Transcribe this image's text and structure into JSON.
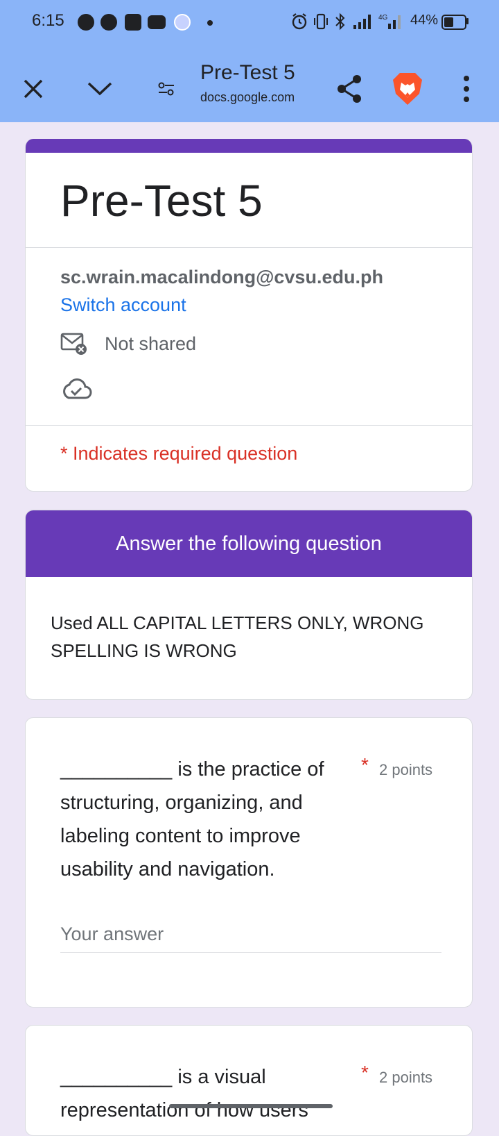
{
  "status_bar": {
    "time": "6:15",
    "battery": "44%",
    "icons": [
      "messenger-icon",
      "shopee-icon",
      "youtube-icon",
      "app-notification-icon",
      "alarm-icon",
      "vibrate-icon",
      "bluetooth-icon",
      "signal-icon",
      "4g-signal-icon",
      "battery-icon"
    ]
  },
  "browser": {
    "title": "Pre-Test 5",
    "url": "docs.google.com",
    "icons": [
      "close-icon",
      "chevron-down-icon",
      "site-settings-icon",
      "share-icon",
      "brave-lion-icon",
      "more-vert-icon"
    ]
  },
  "colors": {
    "accent": "#673ab7",
    "background": "#ede7f6",
    "chrome": "#8ab4f8",
    "link": "#1a73e8",
    "required": "#d93025"
  },
  "form": {
    "title": "Pre-Test 5",
    "account_email": "sc.wrain.macalindong@cvsu.edu.ph",
    "switch_account": "Switch account",
    "not_shared": "Not shared",
    "required_note": "* Indicates required question"
  },
  "section": {
    "title": "Answer the following question",
    "description": "Used ALL CAPITAL LETTERS ONLY, WRONG SPELLING IS WRONG"
  },
  "questions": [
    {
      "text": "__________ is the practice of structuring, organizing, and labeling content to improve usability and navigation.",
      "required_mark": "*",
      "points": "2 points",
      "placeholder": "Your answer"
    },
    {
      "text": "__________ is a visual representation of how users",
      "required_mark": "*",
      "points": "2 points"
    }
  ]
}
